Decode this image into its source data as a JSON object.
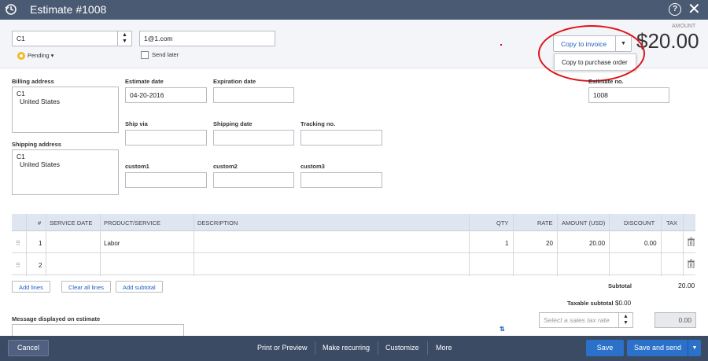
{
  "window": {
    "title": "Estimate #1008",
    "help_glyph": "?",
    "close_glyph": "✕"
  },
  "customer": {
    "name": "C1",
    "email": "1@1.com"
  },
  "status": {
    "label": "Pending"
  },
  "send_later": {
    "label": "Send later"
  },
  "amount": {
    "label": "AMOUNT",
    "value": "$20.00"
  },
  "copy_menu": {
    "button_label": "Copy to invoice",
    "option": "Copy to purchase order"
  },
  "billing": {
    "label": "Billing address",
    "line1": "C1",
    "line2": "United States"
  },
  "shipping": {
    "label": "Shipping address",
    "line1": "C1",
    "line2": "United States"
  },
  "dates": {
    "estimate_label": "Estimate date",
    "estimate_value": "04-20-2016",
    "expiration_label": "Expiration date",
    "ship_via_label": "Ship via",
    "shipping_date_label": "Shipping date",
    "tracking_label": "Tracking no."
  },
  "custom": {
    "c1": "custom1",
    "c2": "custom2",
    "c3": "custom3"
  },
  "estimate_no": {
    "label": "Estimate no.",
    "value": "1008"
  },
  "table": {
    "headers": {
      "num": "#",
      "service_date": "SERVICE DATE",
      "product": "PRODUCT/SERVICE",
      "description": "DESCRIPTION",
      "qty": "QTY",
      "rate": "RATE",
      "amount": "AMOUNT (USD)",
      "discount": "DISCOUNT",
      "tax": "TAX"
    },
    "rows": [
      {
        "num": "1",
        "product": "Labor",
        "qty": "1",
        "rate": "20",
        "amount": "20.00",
        "discount": "0.00"
      },
      {
        "num": "2",
        "product": "",
        "qty": "",
        "rate": "",
        "amount": "",
        "discount": ""
      }
    ]
  },
  "line_buttons": {
    "add_lines": "Add lines",
    "clear_all": "Clear all lines",
    "add_subtotal": "Add subtotal"
  },
  "totals": {
    "subtotal_label": "Subtotal",
    "subtotal_value": "20.00",
    "taxable_label": "Taxable subtotal",
    "taxable_value": "$0.00",
    "tax_rate_placeholder": "Select a sales tax rate",
    "tax_value": "0.00"
  },
  "message": {
    "label": "Message displayed on estimate"
  },
  "footer": {
    "cancel": "Cancel",
    "print": "Print or Preview",
    "recurring": "Make recurring",
    "customize": "Customize",
    "more": "More",
    "save": "Save",
    "save_send": "Save and send"
  },
  "colors": {
    "header": "#4a5a72",
    "footer": "#3b4b63",
    "accent": "#2b70c9",
    "annotation": "#e0131a",
    "table_header": "#dfe6f2"
  }
}
